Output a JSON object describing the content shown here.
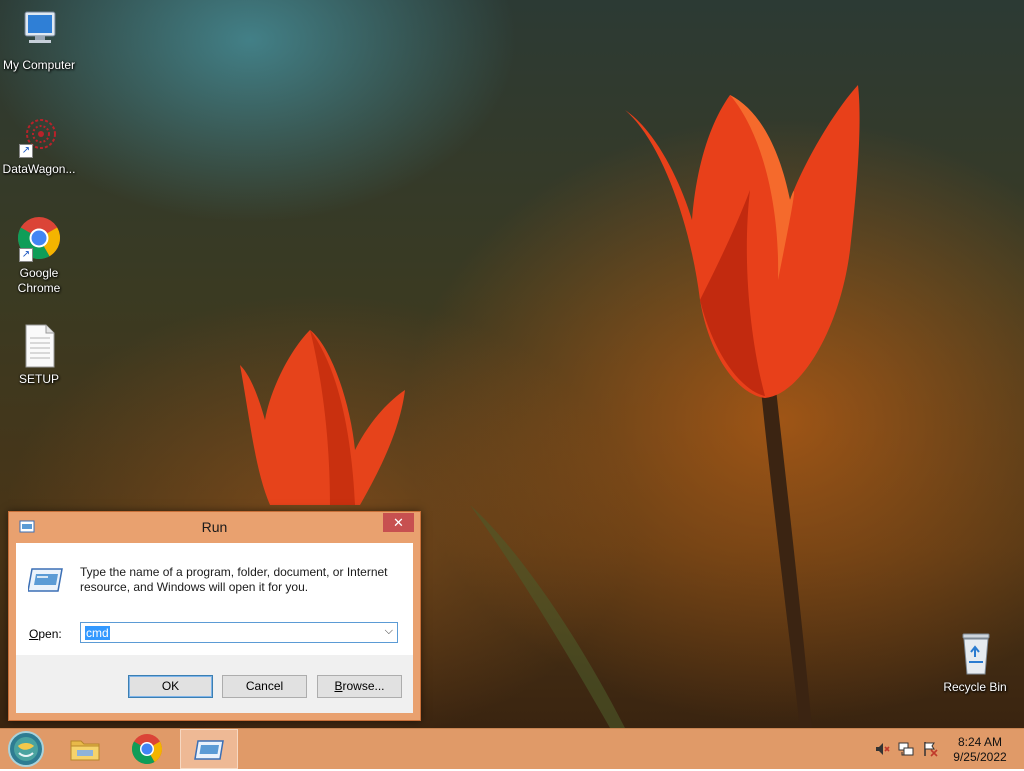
{
  "desktop": {
    "icons": [
      {
        "label": "My Computer"
      },
      {
        "label": "DataWagon..."
      },
      {
        "label": "Google Chrome"
      },
      {
        "label": "SETUP"
      },
      {
        "label": "Recycle Bin"
      }
    ]
  },
  "run_dialog": {
    "title": "Run",
    "close_glyph": "✕",
    "description": "Type the name of a program, folder, document, or Internet resource, and Windows will open it for you.",
    "open_label_accel": "O",
    "open_label_rest": "pen:",
    "open_value": "cmd",
    "ok_label": "OK",
    "cancel_label": "Cancel",
    "browse_label_accel": "B",
    "browse_label_rest": "rowse..."
  },
  "taskbar": {
    "pinned": [
      {
        "icon": "file-explorer-icon"
      },
      {
        "icon": "chrome-icon"
      },
      {
        "icon": "run-icon",
        "active": true
      }
    ],
    "tray_icons": [
      "volume-muted-icon",
      "network-icon",
      "action-center-icon"
    ],
    "clock": {
      "time": "8:24 AM",
      "date": "9/25/2022"
    }
  },
  "colors": {
    "accent": "#e09a68",
    "dialog_frame": "#e9a16f",
    "close_button": "#c75050",
    "selection": "#3399ff"
  }
}
